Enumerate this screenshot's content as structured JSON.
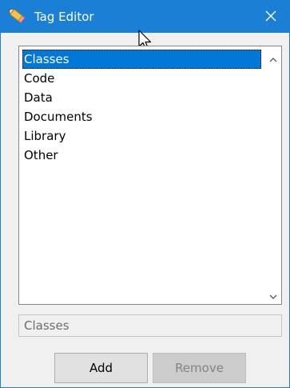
{
  "window": {
    "title": "Tag Editor",
    "accent_color": "#1b7fd6",
    "app_icon": "pencil-icon",
    "close_icon": "close-icon"
  },
  "tag_list": {
    "items": [
      "Classes",
      "Code",
      "Data",
      "Documents",
      "Library",
      "Other"
    ],
    "selected_index": 0,
    "selection_color": "#0078d7",
    "scroll_up_icon": "chevron-up-icon",
    "scroll_down_icon": "chevron-down-icon"
  },
  "tag_input": {
    "value": "Classes"
  },
  "buttons": {
    "add_label": "Add",
    "remove_label": "Remove"
  }
}
